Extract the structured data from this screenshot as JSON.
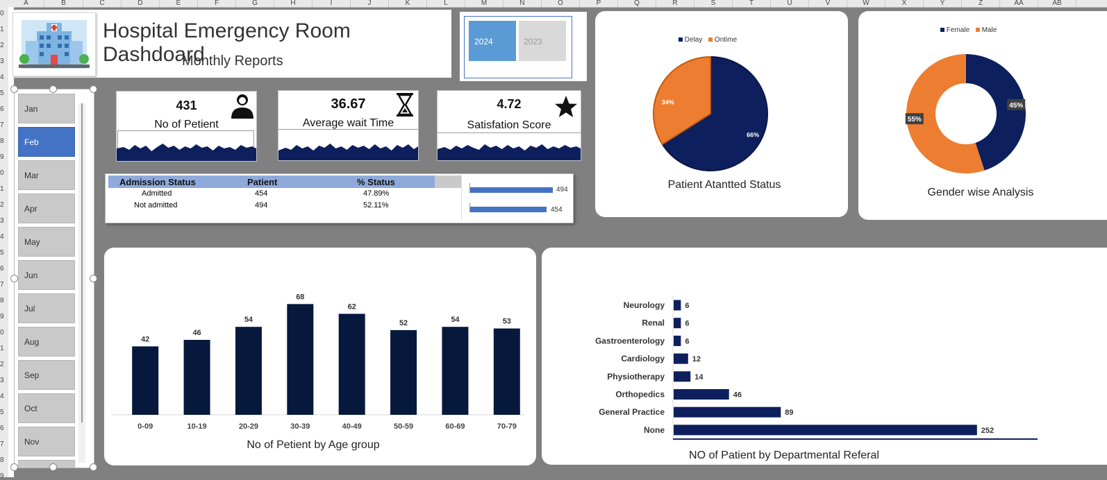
{
  "spreadsheet": {
    "columns": [
      "A",
      "B",
      "C",
      "D",
      "E",
      "F",
      "G",
      "H",
      "I",
      "J",
      "K",
      "L",
      "M",
      "N",
      "O",
      "P",
      "Q",
      "R",
      "S",
      "T",
      "U",
      "V",
      "W",
      "X",
      "Y",
      "Z",
      "AA",
      "AB"
    ],
    "rows": [
      "0",
      "1",
      "2",
      "3",
      "4",
      "5",
      "6",
      "7",
      "8",
      "9",
      "0",
      "1",
      "2",
      "3",
      "4",
      "5",
      "6",
      "7",
      "8",
      "9",
      "0",
      "1",
      "2",
      "3",
      "4",
      "5",
      "6",
      "7",
      "8",
      "9"
    ]
  },
  "header": {
    "title": "Hospital Emergency Room Dashdoard",
    "subtitle": "Monthly Reports"
  },
  "year_slicer": {
    "years": [
      "2024",
      "2023"
    ],
    "selected": "2024"
  },
  "month_slicer": {
    "months": [
      "Jan",
      "Feb",
      "Mar",
      "Apr",
      "May",
      "Jun",
      "Jul",
      "Aug",
      "Sep",
      "Oct",
      "Nov"
    ],
    "selected": "Feb"
  },
  "kpis": [
    {
      "value": "431",
      "label": "No of Petient",
      "icon": "person-icon"
    },
    {
      "value": "36.67",
      "label": "Average wait Time",
      "icon": "hourglass-icon"
    },
    {
      "value": "4.72",
      "label": "Satisfation Score",
      "icon": "star-icon"
    }
  ],
  "admission_table": {
    "headers": [
      "Admission Status",
      "Patient",
      "% Status"
    ],
    "rows": [
      [
        "Admitted",
        "454",
        "47.89%"
      ],
      [
        "Not admitted",
        "494",
        "52.11%"
      ]
    ],
    "bar_labels": [
      "494",
      "454"
    ],
    "bar_values": [
      494,
      454
    ]
  },
  "colors": {
    "navy": "#0d1f5c",
    "dark_navy": "#07183d",
    "orange": "#ed7d31",
    "slicer_blue": "#4472c4"
  },
  "chart_data": [
    {
      "type": "pie",
      "title": "Patient Atantted Status",
      "legend": [
        "Delay",
        "Ontime"
      ],
      "legend_position": "top",
      "values": [
        66,
        34
      ],
      "labels": [
        "66%",
        "34%"
      ]
    },
    {
      "type": "pie",
      "subtype": "donut",
      "title": "Gender wise Analysis",
      "legend": [
        "Female",
        "Male"
      ],
      "legend_position": "top",
      "values": [
        45,
        55
      ],
      "labels": [
        "45%",
        "55%"
      ]
    },
    {
      "type": "bar",
      "title": "No of Petient by Age group",
      "categories": [
        "0-09",
        "10-19",
        "20-29",
        "30-39",
        "40-49",
        "50-59",
        "60-69",
        "70-79"
      ],
      "values": [
        42,
        46,
        54,
        68,
        62,
        52,
        54,
        53
      ],
      "ylim": [
        0,
        80
      ]
    },
    {
      "type": "bar",
      "orientation": "horizontal",
      "title": "NO of Patient by Departmental Referal",
      "categories": [
        "Neurology",
        "Renal",
        "Gastroenterology",
        "Cardiology",
        "Physiotherapy",
        "Orthopedics",
        "General Practice",
        "None"
      ],
      "values": [
        6,
        6,
        6,
        12,
        14,
        46,
        89,
        252
      ],
      "xlim": [
        0,
        300
      ]
    }
  ]
}
